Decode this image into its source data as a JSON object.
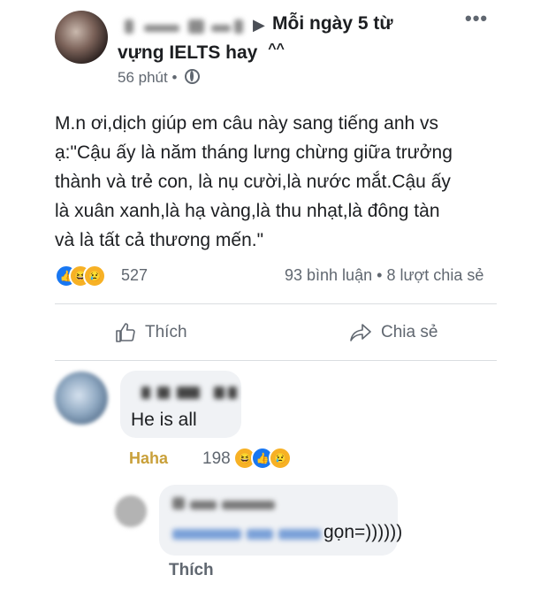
{
  "post": {
    "group_name_line1": "Mỗi ngày 5 từ",
    "group_name_line2": "vựng IELTS hay",
    "group_suffix": "^^",
    "time": "56 phút",
    "time_separator": "•",
    "text_lines": [
      "M.n ơi,dịch giúp em câu này sang tiếng anh vs",
      "ạ:\"Cậu ấy là năm tháng lưng chừng giữa trưởng",
      "thành và trẻ con, là nụ cười,là nước mắt.Cậu ấy",
      "là xuân xanh,là hạ vàng,là thu nhạt,là đông tàn",
      "và là tất cả thương mến.\""
    ],
    "reaction_count": "527",
    "comments_count": "93 bình luận",
    "stats_separator": "•",
    "shares_count": "8 lượt chia sẻ",
    "like_label": "Thích",
    "share_label": "Chia sẻ",
    "more_icon": "more-dots-icon"
  },
  "comments": [
    {
      "text": "He is all",
      "reaction_label": "Haha",
      "reaction_count": "198"
    },
    {
      "text": "gọn=))))))",
      "like_label": "Thích"
    }
  ],
  "colors": {
    "facebook_blue": "#1877f2",
    "reaction_yellow": "#f7b125",
    "haha_text": "#c9a03a",
    "meta_gray": "#606770",
    "bubble_bg": "#f0f2f5"
  }
}
